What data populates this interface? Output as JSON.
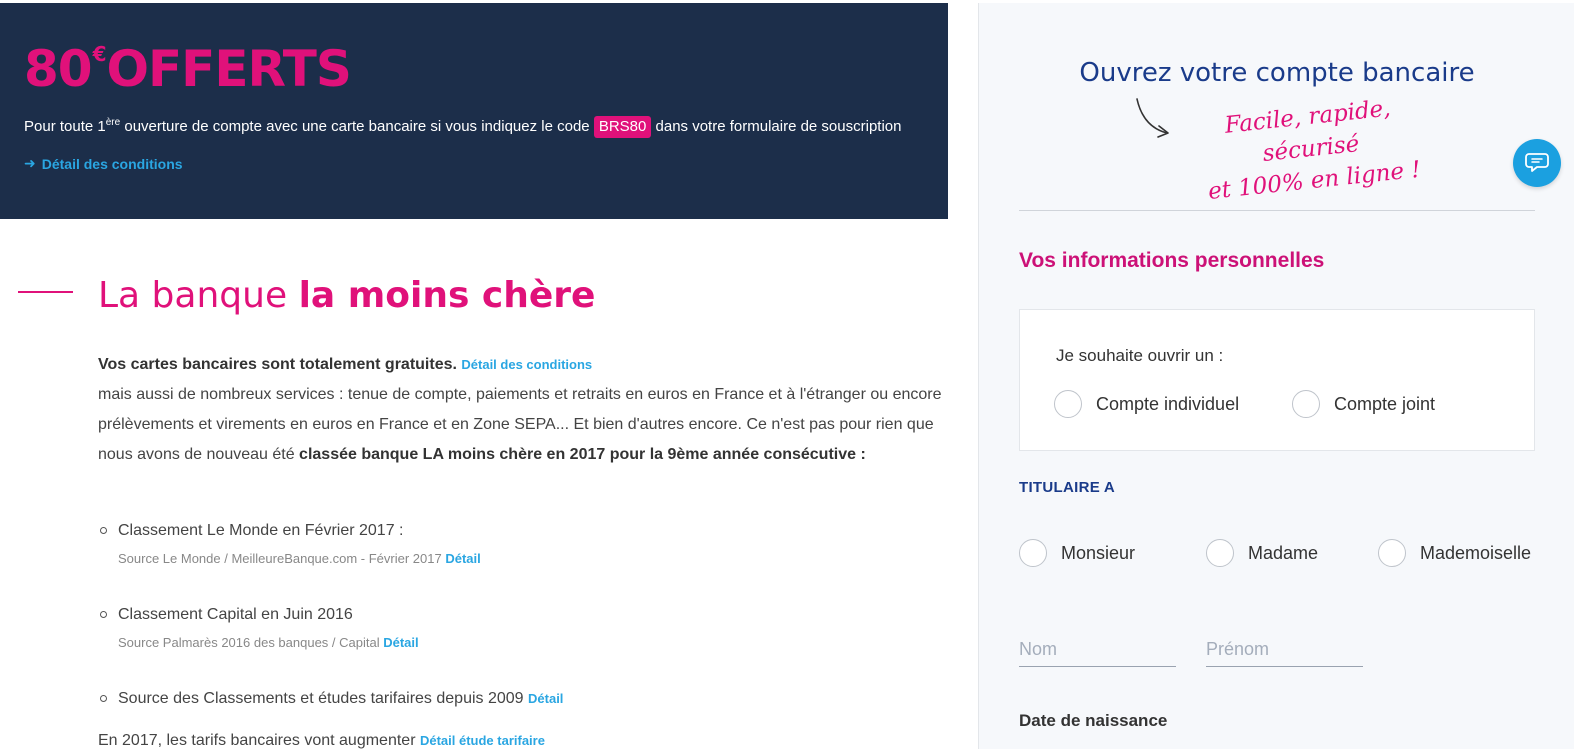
{
  "promo": {
    "amount": "80",
    "currency": "€",
    "offered": "OFFERTS",
    "text_before_sup": "Pour toute 1",
    "text_sup": "ère",
    "text_mid": " ouverture de compte avec une carte bancaire si vous indiquez le code ",
    "code": "BRS80",
    "text_after": " dans votre formulaire de souscription",
    "link_label": "Détail des conditions",
    "colors": {
      "background": "#1c2e4a",
      "accent": "#e0117a",
      "link": "#2aa6e2"
    }
  },
  "main": {
    "title_light": "La banque ",
    "title_bold": "la moins chère",
    "lead": "Vos cartes bancaires sont totalement gratuites.",
    "lead_link": "Détail des conditions",
    "body_text": "mais aussi de nombreux services : tenue de compte, paiements et retraits en euros en France et à l'étranger ou encore prélèvements et virements en euros en France et en Zone SEPA... Et bien d'autres encore. Ce n'est pas pour rien que nous avons de nouveau été ",
    "body_bold": "classée banque LA moins chère en 2017 pour la 9ème année consécutive :",
    "rankings": [
      {
        "title": "Classement Le Monde en Février 2017 :",
        "source": "Source Le Monde / MeilleureBanque.com - Février 2017",
        "link": "Détail"
      },
      {
        "title": "Classement Capital en Juin 2016",
        "source": "Source Palmarès 2016 des banques / Capital",
        "link": "Détail"
      },
      {
        "title": "Source des Classements et études tarifaires depuis 2009",
        "link": "Détail"
      }
    ],
    "bottom_text": "En 2017, les tarifs bancaires vont augmenter",
    "bottom_link": "Détail étude tarifaire"
  },
  "panel": {
    "title": "Ouvrez votre compte bancaire",
    "tagline_line1": "Facile, rapide, sécurisé",
    "tagline_line2": "et 100% en ligne !",
    "section_title": "Vos informations personnelles",
    "account_question": "Je souhaite ouvrir un :",
    "account_options": [
      "Compte individuel",
      "Compte joint"
    ],
    "titulaire_label": "TITULAIRE A",
    "civility_options": [
      "Monsieur",
      "Madame",
      "Mademoiselle"
    ],
    "nom_placeholder": "Nom",
    "prenom_placeholder": "Prénom",
    "dob_label": "Date de naissance",
    "colors": {
      "title": "#1a3b8a",
      "accent": "#cc1177",
      "chat": "#1ba0e0"
    }
  }
}
